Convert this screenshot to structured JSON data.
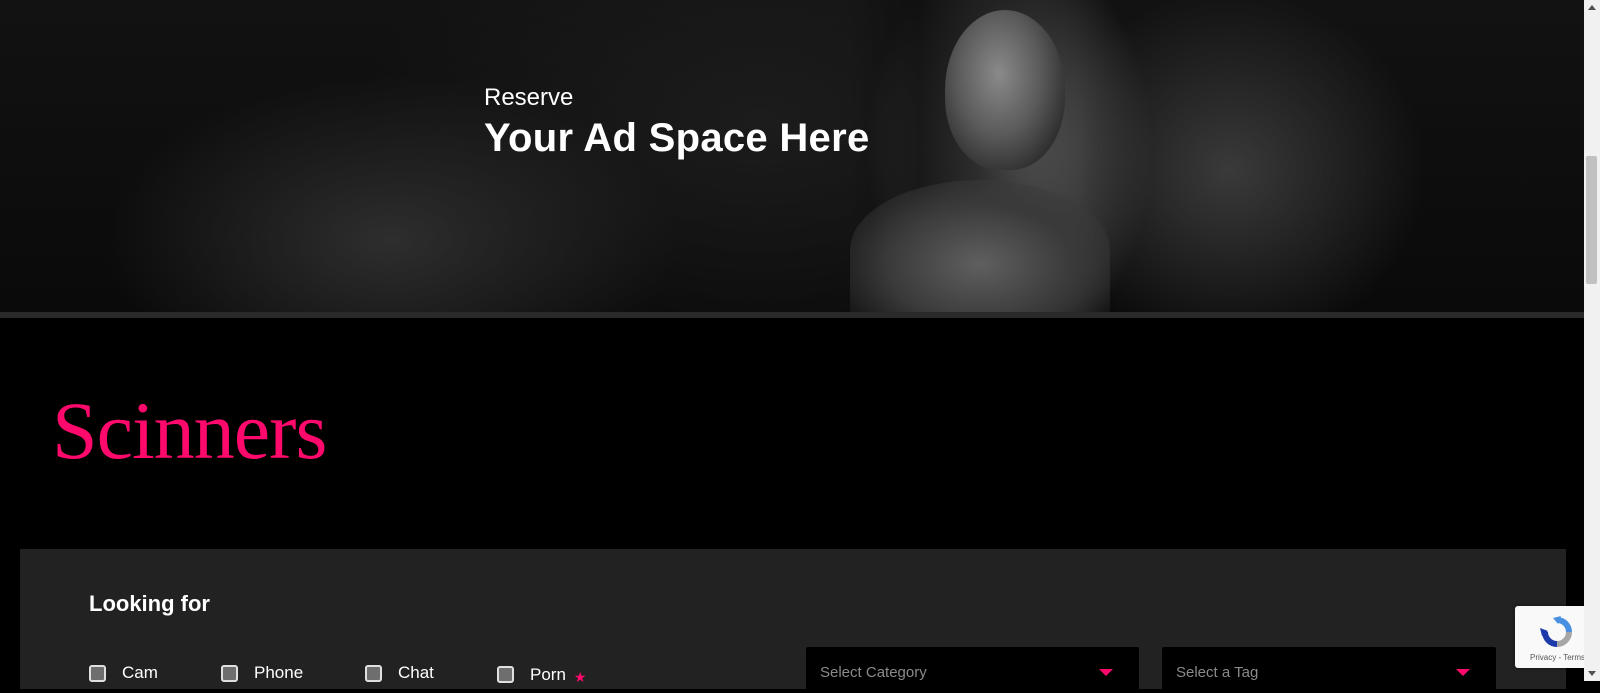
{
  "hero": {
    "kicker": "Reserve",
    "headline": "Your Ad Space Here"
  },
  "brand": {
    "name": "Scinners",
    "color": "#ff0a6c"
  },
  "search": {
    "title": "Looking for",
    "options": [
      {
        "label": "Cam",
        "checked": false
      },
      {
        "label": "Phone",
        "checked": false
      },
      {
        "label": "Chat",
        "checked": false
      },
      {
        "label": "Porn",
        "checked": false,
        "starred": true
      }
    ],
    "category_select": {
      "placeholder": "Select Category"
    },
    "tag_select": {
      "placeholder": "Select a Tag"
    }
  },
  "recaptcha": {
    "footer": "Privacy - Terms",
    "icon": "recaptcha-icon"
  }
}
